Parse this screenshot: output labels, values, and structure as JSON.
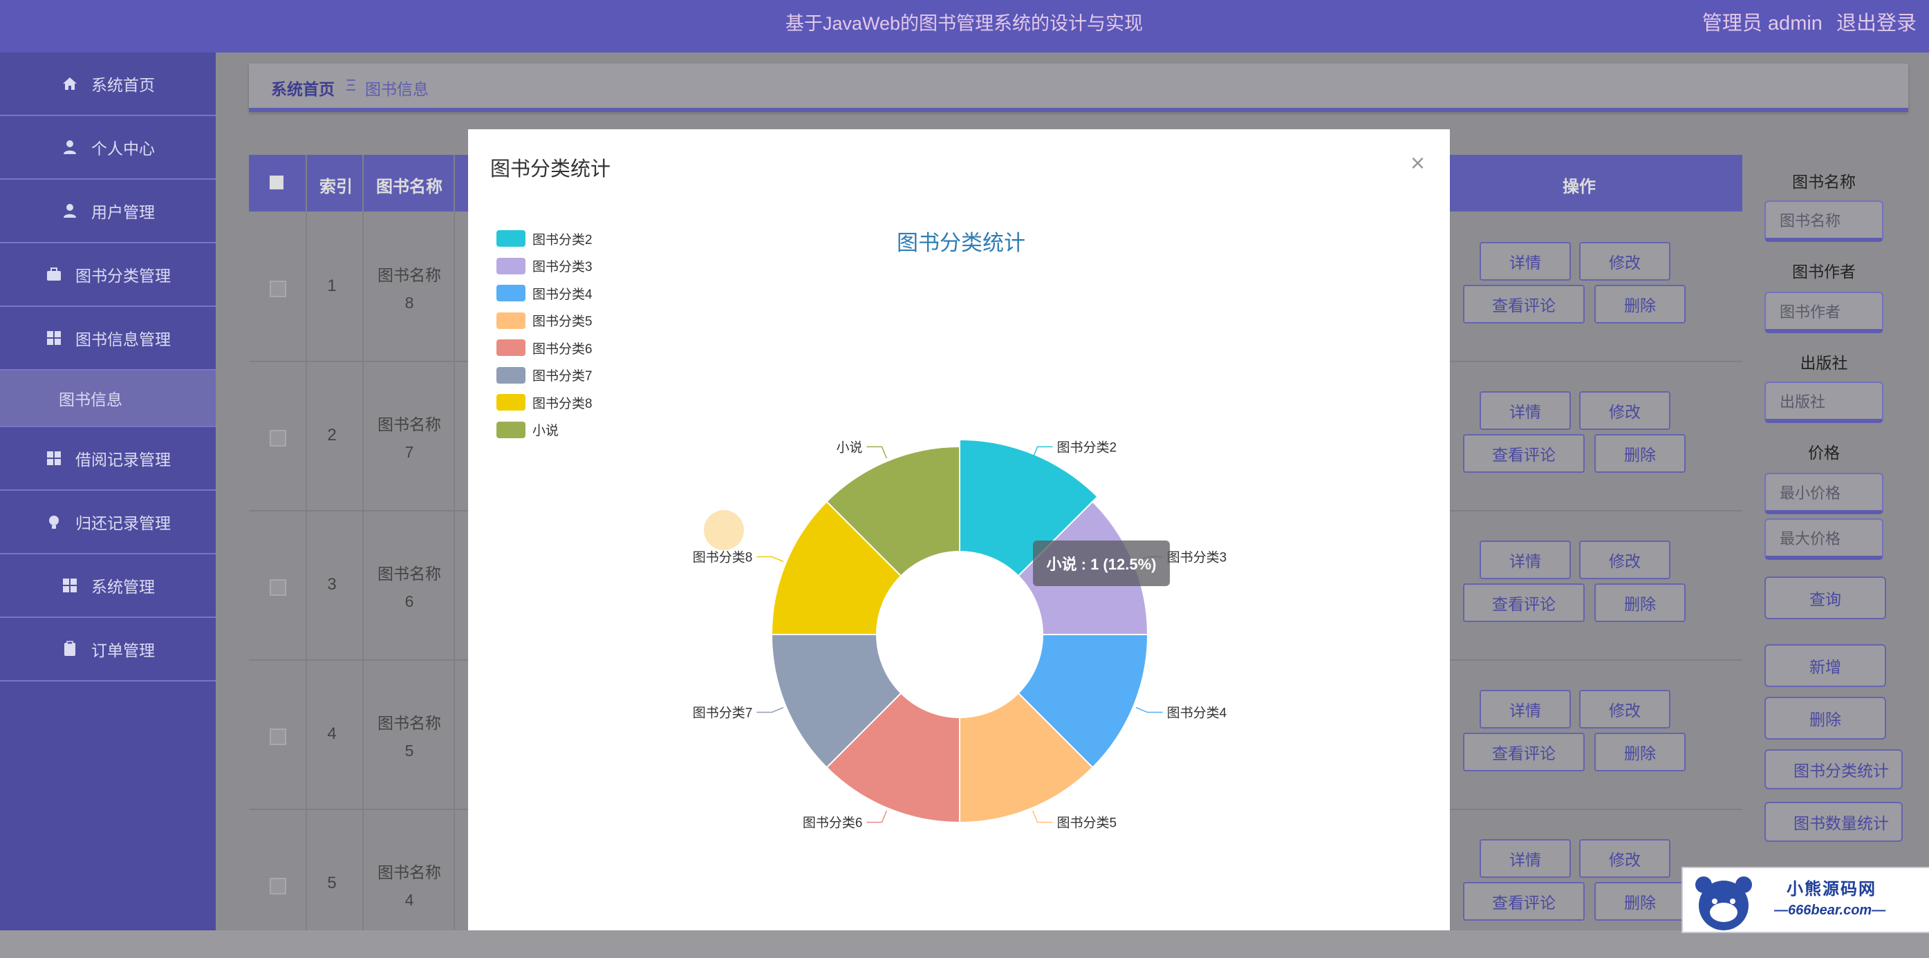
{
  "app_title": "基于JavaWeb的图书管理系统的设计与实现",
  "user_area": {
    "role_user": "管理员 admin",
    "logout": "退出登录"
  },
  "sidebar": {
    "items": [
      {
        "label": "系统首页",
        "icon": "home-icon"
      },
      {
        "label": "个人中心",
        "icon": "user-icon"
      },
      {
        "label": "用户管理",
        "icon": "user-icon"
      },
      {
        "label": "图书分类管理",
        "icon": "briefcase-icon"
      },
      {
        "label": "图书信息管理",
        "icon": "grid-icon"
      },
      {
        "label": "图书信息",
        "icon": ""
      },
      {
        "label": "借阅记录管理",
        "icon": "grid-icon"
      },
      {
        "label": "归还记录管理",
        "icon": "bulb-icon"
      },
      {
        "label": "系统管理",
        "icon": "grid-icon"
      },
      {
        "label": "订单管理",
        "icon": "clipboard-icon"
      }
    ]
  },
  "breadcrumb": {
    "home": "系统首页",
    "sep": "Ξ",
    "current": "图书信息"
  },
  "table": {
    "headers": {
      "index": "索引",
      "name": "图书名称",
      "ops": "操作"
    },
    "rows": [
      {
        "index": "1",
        "name_a": "图书名称",
        "name_b": "8"
      },
      {
        "index": "2",
        "name_a": "图书名称",
        "name_b": "7"
      },
      {
        "index": "3",
        "name_a": "图书名称",
        "name_b": "6"
      },
      {
        "index": "4",
        "name_a": "图书名称",
        "name_b": "5"
      },
      {
        "index": "5",
        "name_a": "图书名称",
        "name_b": "4"
      }
    ],
    "row_buttons": {
      "detail": "详情",
      "edit": "修改",
      "comments": "查看评论",
      "delete": "删除"
    }
  },
  "search_panel": {
    "book_name_label": "图书名称",
    "book_name_placeholder": "图书名称",
    "author_label": "图书作者",
    "author_placeholder": "图书作者",
    "publisher_label": "出版社",
    "publisher_placeholder": "出版社",
    "price_label": "价格",
    "min_price_placeholder": "最小价格",
    "max_price_placeholder": "最大价格",
    "query": "查询",
    "add": "新增",
    "delete": "删除",
    "category_stats": "图书分类统计",
    "count_stats": "图书数量统计"
  },
  "modal": {
    "title": "图书分类统计",
    "close": "×"
  },
  "chart_data": {
    "type": "pie",
    "title": "图书分类统计",
    "legend_position": "top-left",
    "donut": true,
    "categories": [
      "图书分类2",
      "图书分类3",
      "图书分类4",
      "图书分类5",
      "图书分类6",
      "图书分类7",
      "图书分类8",
      "小说"
    ],
    "values": [
      1,
      1,
      1,
      1,
      1,
      1,
      1,
      1
    ],
    "colors": [
      "#26c6da",
      "#b9a9e3",
      "#56aef6",
      "#ffc07c",
      "#e98b83",
      "#8f9db5",
      "#f0cd00",
      "#9aae50"
    ],
    "tooltip": "小说 : 1 (12.5%)"
  },
  "watermark": {
    "line1": "小熊源码网",
    "line2": "—666bear.com—"
  }
}
